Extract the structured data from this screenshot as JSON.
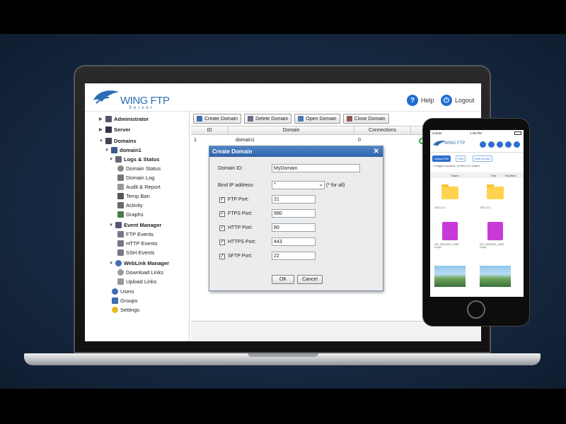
{
  "app": {
    "logo_text": "WING FTP",
    "logo_sub": "Server",
    "help_label": "Help",
    "logout_label": "Logout"
  },
  "sidebar": {
    "administrator": "Administrator",
    "server": "Server",
    "domains": "Domains",
    "domain1": "domain1",
    "logs_status": "Logs & Status",
    "domain_status": "Domain Status",
    "domain_log": "Domain Log",
    "audit_report": "Audit & Report",
    "temp_ban": "Temp Ban",
    "activity": "Activity",
    "graphs": "Graphs",
    "event_manager": "Event Manager",
    "ftp_events": "FTP Events",
    "http_events": "HTTP Events",
    "ssh_events": "SSH Events",
    "weblink_manager": "WebLink Manager",
    "download_links": "Download Links",
    "upload_links": "Upload Links",
    "users": "Users",
    "groups": "Groups",
    "settings": "Settings"
  },
  "toolbar": {
    "create": "Create Domain",
    "delete": "Delete Domain",
    "open": "Open Domain",
    "close": "Close Domain"
  },
  "grid": {
    "headers": [
      "ID",
      "Domain",
      "Connections"
    ],
    "rows": [
      {
        "id": "1",
        "domain": "domain1",
        "connections": "0"
      }
    ]
  },
  "dialog": {
    "title": "Create Domain",
    "close_symbol": "✕",
    "domain_id_label": "Domain ID:",
    "domain_id_value": "MyDomain",
    "bind_ip_label": "Bind IP address:",
    "bind_ip_value": "*",
    "bind_ip_hint": "(* for all)",
    "ports": [
      {
        "label": "FTP Port:",
        "value": "21",
        "checked": true
      },
      {
        "label": "FTPS Port:",
        "value": "990",
        "checked": true
      },
      {
        "label": "HTTP Port:",
        "value": "80",
        "checked": true
      },
      {
        "label": "HTTPS Port:",
        "value": "443",
        "checked": true
      },
      {
        "label": "SFTP Port:",
        "value": "22",
        "checked": true
      }
    ],
    "ok_label": "OK",
    "cancel_label": "Cancel"
  },
  "phone": {
    "carrier": "Carrier",
    "time": "1:46 PM",
    "logo_text": "WING FTP",
    "btn_upload": "Upload File",
    "btn_files": "Files",
    "btn_webaccess": "Web Access",
    "path": "/ Images  Includes: 10 files & 0 folders",
    "col_name": "Name",
    "col_size": "Size",
    "col_modified": "Modified",
    "tiles": [
      {
        "kind": "folder",
        "caption": "2021-12-1"
      },
      {
        "kind": "folder",
        "caption": "2021-12-1"
      },
      {
        "kind": "video",
        "caption": "VID_20211029_14491 5.mp4"
      },
      {
        "kind": "video",
        "caption": "VID_20211029_14491 5.mp4"
      },
      {
        "kind": "image",
        "caption": ""
      },
      {
        "kind": "image",
        "caption": ""
      }
    ]
  },
  "colors": {
    "brand_blue": "#2a6fb5",
    "dialog_title": "#2f63a8",
    "status_green": "#22a833"
  }
}
